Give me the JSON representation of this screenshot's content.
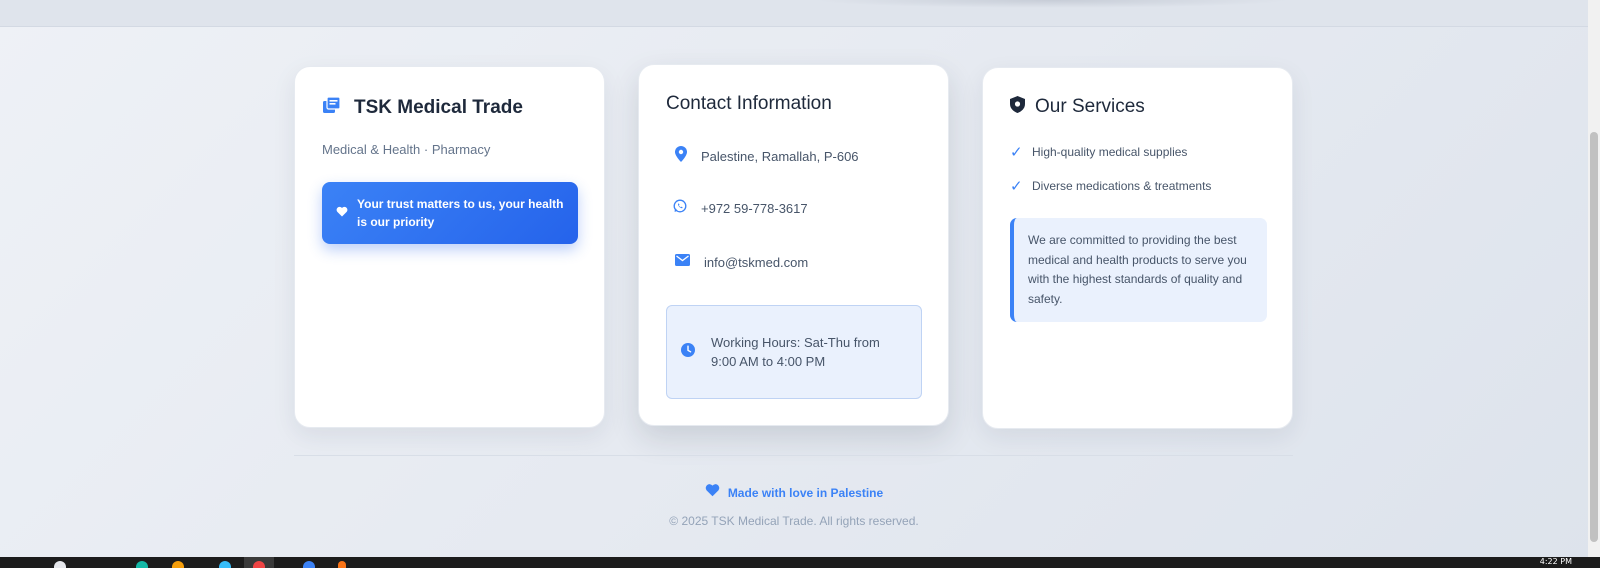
{
  "company": {
    "name": "TSK Medical Trade",
    "subtitle": "Medical & Health · Pharmacy",
    "trust_message": "Your trust matters to us, your health is our priority"
  },
  "contact": {
    "title": "Contact Information",
    "address": "Palestine, Ramallah, P-606",
    "phone": "+972 59-778-3617",
    "email": "info@tskmed.com",
    "hours": "Working Hours: Sat-Thu from 9:00 AM to 4:00 PM"
  },
  "services": {
    "title": "Our Services",
    "items": [
      "High-quality medical supplies",
      "Diverse medications & treatments"
    ],
    "commitment": "We are committed to providing the best medical and health products to serve you with the highest standards of quality and safety."
  },
  "footer": {
    "made_with_love": "Made with love in Palestine",
    "copyright": "© 2025 TSK Medical Trade. All rights reserved."
  },
  "taskbar": {
    "time": "4:22 PM"
  },
  "colors": {
    "accent": "#3b82f6",
    "accent_dark": "#2563eb",
    "text_dark": "#1e293b",
    "text_muted": "#64748b"
  },
  "icons": {
    "company": "pharmacy-building-icon",
    "trust": "heart-icon",
    "address": "map-pin-icon",
    "phone": "whatsapp-icon",
    "email": "envelope-icon",
    "hours": "clock-icon",
    "services": "shield-icon",
    "check": "check-icon",
    "love": "heart-icon"
  }
}
